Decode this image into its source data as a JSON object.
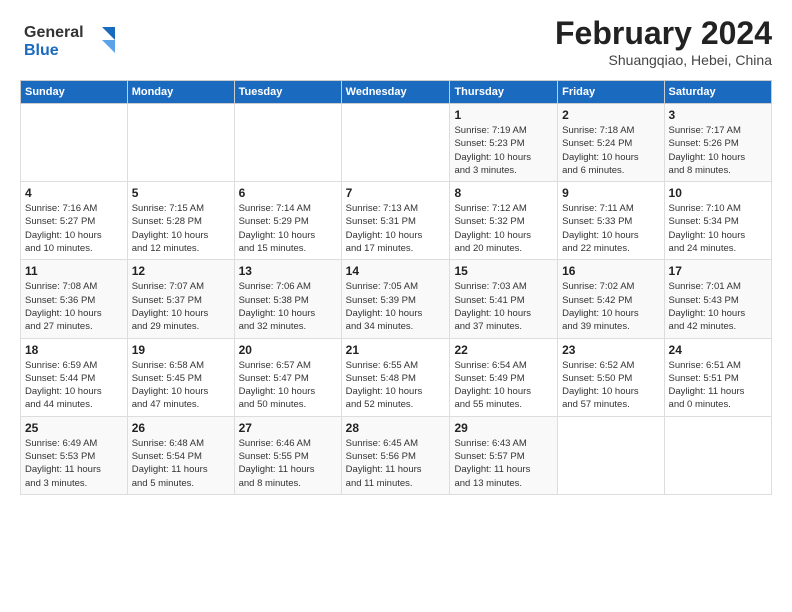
{
  "logo": {
    "line1": "General",
    "line2": "Blue"
  },
  "title": "February 2024",
  "subtitle": "Shuangqiao, Hebei, China",
  "days_of_week": [
    "Sunday",
    "Monday",
    "Tuesday",
    "Wednesday",
    "Thursday",
    "Friday",
    "Saturday"
  ],
  "weeks": [
    [
      {
        "day": "",
        "info": ""
      },
      {
        "day": "",
        "info": ""
      },
      {
        "day": "",
        "info": ""
      },
      {
        "day": "",
        "info": ""
      },
      {
        "day": "1",
        "info": "Sunrise: 7:19 AM\nSunset: 5:23 PM\nDaylight: 10 hours\nand 3 minutes."
      },
      {
        "day": "2",
        "info": "Sunrise: 7:18 AM\nSunset: 5:24 PM\nDaylight: 10 hours\nand 6 minutes."
      },
      {
        "day": "3",
        "info": "Sunrise: 7:17 AM\nSunset: 5:26 PM\nDaylight: 10 hours\nand 8 minutes."
      }
    ],
    [
      {
        "day": "4",
        "info": "Sunrise: 7:16 AM\nSunset: 5:27 PM\nDaylight: 10 hours\nand 10 minutes."
      },
      {
        "day": "5",
        "info": "Sunrise: 7:15 AM\nSunset: 5:28 PM\nDaylight: 10 hours\nand 12 minutes."
      },
      {
        "day": "6",
        "info": "Sunrise: 7:14 AM\nSunset: 5:29 PM\nDaylight: 10 hours\nand 15 minutes."
      },
      {
        "day": "7",
        "info": "Sunrise: 7:13 AM\nSunset: 5:31 PM\nDaylight: 10 hours\nand 17 minutes."
      },
      {
        "day": "8",
        "info": "Sunrise: 7:12 AM\nSunset: 5:32 PM\nDaylight: 10 hours\nand 20 minutes."
      },
      {
        "day": "9",
        "info": "Sunrise: 7:11 AM\nSunset: 5:33 PM\nDaylight: 10 hours\nand 22 minutes."
      },
      {
        "day": "10",
        "info": "Sunrise: 7:10 AM\nSunset: 5:34 PM\nDaylight: 10 hours\nand 24 minutes."
      }
    ],
    [
      {
        "day": "11",
        "info": "Sunrise: 7:08 AM\nSunset: 5:36 PM\nDaylight: 10 hours\nand 27 minutes."
      },
      {
        "day": "12",
        "info": "Sunrise: 7:07 AM\nSunset: 5:37 PM\nDaylight: 10 hours\nand 29 minutes."
      },
      {
        "day": "13",
        "info": "Sunrise: 7:06 AM\nSunset: 5:38 PM\nDaylight: 10 hours\nand 32 minutes."
      },
      {
        "day": "14",
        "info": "Sunrise: 7:05 AM\nSunset: 5:39 PM\nDaylight: 10 hours\nand 34 minutes."
      },
      {
        "day": "15",
        "info": "Sunrise: 7:03 AM\nSunset: 5:41 PM\nDaylight: 10 hours\nand 37 minutes."
      },
      {
        "day": "16",
        "info": "Sunrise: 7:02 AM\nSunset: 5:42 PM\nDaylight: 10 hours\nand 39 minutes."
      },
      {
        "day": "17",
        "info": "Sunrise: 7:01 AM\nSunset: 5:43 PM\nDaylight: 10 hours\nand 42 minutes."
      }
    ],
    [
      {
        "day": "18",
        "info": "Sunrise: 6:59 AM\nSunset: 5:44 PM\nDaylight: 10 hours\nand 44 minutes."
      },
      {
        "day": "19",
        "info": "Sunrise: 6:58 AM\nSunset: 5:45 PM\nDaylight: 10 hours\nand 47 minutes."
      },
      {
        "day": "20",
        "info": "Sunrise: 6:57 AM\nSunset: 5:47 PM\nDaylight: 10 hours\nand 50 minutes."
      },
      {
        "day": "21",
        "info": "Sunrise: 6:55 AM\nSunset: 5:48 PM\nDaylight: 10 hours\nand 52 minutes."
      },
      {
        "day": "22",
        "info": "Sunrise: 6:54 AM\nSunset: 5:49 PM\nDaylight: 10 hours\nand 55 minutes."
      },
      {
        "day": "23",
        "info": "Sunrise: 6:52 AM\nSunset: 5:50 PM\nDaylight: 10 hours\nand 57 minutes."
      },
      {
        "day": "24",
        "info": "Sunrise: 6:51 AM\nSunset: 5:51 PM\nDaylight: 11 hours\nand 0 minutes."
      }
    ],
    [
      {
        "day": "25",
        "info": "Sunrise: 6:49 AM\nSunset: 5:53 PM\nDaylight: 11 hours\nand 3 minutes."
      },
      {
        "day": "26",
        "info": "Sunrise: 6:48 AM\nSunset: 5:54 PM\nDaylight: 11 hours\nand 5 minutes."
      },
      {
        "day": "27",
        "info": "Sunrise: 6:46 AM\nSunset: 5:55 PM\nDaylight: 11 hours\nand 8 minutes."
      },
      {
        "day": "28",
        "info": "Sunrise: 6:45 AM\nSunset: 5:56 PM\nDaylight: 11 hours\nand 11 minutes."
      },
      {
        "day": "29",
        "info": "Sunrise: 6:43 AM\nSunset: 5:57 PM\nDaylight: 11 hours\nand 13 minutes."
      },
      {
        "day": "",
        "info": ""
      },
      {
        "day": "",
        "info": ""
      }
    ]
  ]
}
